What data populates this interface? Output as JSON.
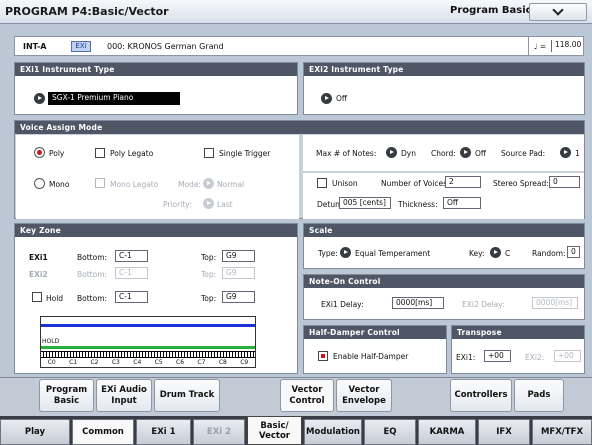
{
  "title": "PROGRAM P4:Basic/Vector",
  "page_select": "Program Basic",
  "program": {
    "bank": "INT-A",
    "exi_badge": "EXi",
    "name": "000: KRONOS German Grand",
    "tempo_label": "♩ =",
    "tempo": "118.00"
  },
  "exi1": {
    "header": "EXi1 Instrument Type",
    "value": "SGX-1 Premium Piano"
  },
  "exi2": {
    "header": "EXi2 Instrument Type",
    "value": "Off"
  },
  "voice": {
    "header": "Voice Assign Mode",
    "poly": "Poly",
    "poly_legato": "Poly Legato",
    "single_trigger": "Single Trigger",
    "mono": "Mono",
    "mono_legato": "Mono Legato",
    "mode_label": "Mode:",
    "mode_value": "Normal",
    "priority_label": "Priority:",
    "priority_value": "Last",
    "max_notes_label": "Max # of Notes:",
    "max_notes_value": "Dyn",
    "chord_label": "Chord:",
    "chord_value": "Off",
    "source_pad_label": "Source Pad:",
    "source_pad_value": "1",
    "unison": "Unison",
    "num_voices_label": "Number of Voices:",
    "num_voices": "2",
    "stereo_spread_label": "Stereo Spread:",
    "stereo_spread": "0",
    "detune_label": "Detune:",
    "detune": "005 [cents]",
    "thickness_label": "Thickness:",
    "thickness": "Off"
  },
  "keyzone": {
    "header": "Key Zone",
    "exi1": "EXi1",
    "exi2": "EXi2",
    "bottom_label": "Bottom:",
    "top_label": "Top:",
    "exi1_bottom": "C-1",
    "exi1_top": "G9",
    "exi2_bottom": "C-1",
    "exi2_top": "G9",
    "hold": "Hold",
    "hold_bottom": "C-1",
    "hold_top": "G9",
    "kb_hold_label": "HOLD",
    "octaves": [
      "C0",
      "C1",
      "C2",
      "C3",
      "C4",
      "C5",
      "C6",
      "C7",
      "C8",
      "C9"
    ]
  },
  "scale": {
    "header": "Scale",
    "type_label": "Type:",
    "type_value": "Equal Temperament",
    "key_label": "Key:",
    "key_value": "C",
    "random_label": "Random:",
    "random": "0"
  },
  "noteon": {
    "header": "Note-On Control",
    "exi1_label": "EXi1 Delay:",
    "exi1_delay": "0000[ms]",
    "exi2_label": "EXi2 Delay:",
    "exi2_delay": "0000[ms]"
  },
  "halfdamper": {
    "header": "Half-Damper Control",
    "label": "Enable Half-Damper"
  },
  "transpose": {
    "header": "Transpose",
    "exi1_label": "EXi1:",
    "exi1": "+00",
    "exi2_label": "EXi2:",
    "exi2": "+00"
  },
  "tabs1": [
    "Program Basic",
    "EXi Audio Input",
    "Drum Track",
    "Vector Control",
    "Vector Envelope",
    "Controllers",
    "Pads"
  ],
  "tabs2": [
    "Play",
    "Common",
    "EXi 1",
    "EXi 2",
    "Basic/ Vector",
    "Modulation",
    "EQ",
    "KARMA",
    "IFX",
    "MFX/TFX"
  ]
}
